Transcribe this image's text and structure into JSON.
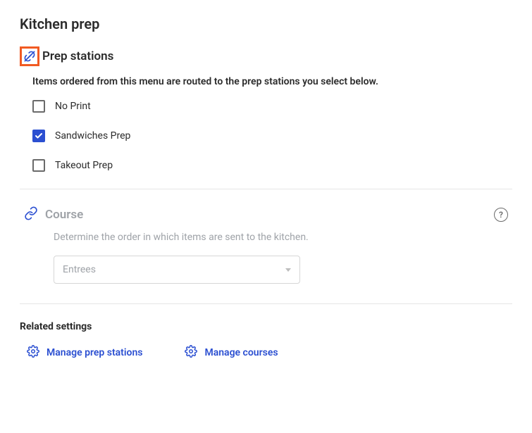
{
  "pageTitle": "Kitchen prep",
  "prepStations": {
    "title": "Prep stations",
    "description": "Items ordered from this menu are routed to the prep stations you select below.",
    "items": [
      {
        "label": "No Print",
        "checked": false
      },
      {
        "label": "Sandwiches Prep",
        "checked": true
      },
      {
        "label": "Takeout Prep",
        "checked": false
      }
    ]
  },
  "course": {
    "title": "Course",
    "description": "Determine the order in which items are sent to the kitchen.",
    "selected": "Entrees"
  },
  "related": {
    "heading": "Related settings",
    "links": [
      {
        "label": "Manage prep stations"
      },
      {
        "label": "Manage courses"
      }
    ]
  },
  "helpGlyph": "?"
}
